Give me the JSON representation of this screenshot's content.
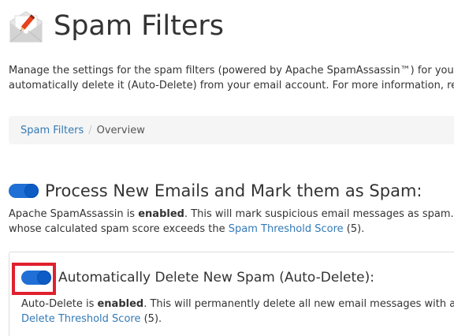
{
  "header": {
    "title": "Spam Filters",
    "icon": "envelope-pencil-icon"
  },
  "description": {
    "line1": "Manage the settings for the spam filters (powered by Apache SpamAssassin™) for your",
    "line2": "automatically delete it (Auto-Delete) from your email account. For more information, re"
  },
  "breadcrumb": {
    "link": "Spam Filters",
    "separator": "/",
    "current": "Overview"
  },
  "process_section": {
    "title": "Process New Emails and Mark them as Spam:",
    "toggle_state": "on",
    "desc_prefix": "Apache SpamAssassin is ",
    "desc_status": "enabled",
    "desc_middle": ". This will mark suspicious email messages as spam. T",
    "desc_line2_prefix": "whose calculated spam score exceeds the ",
    "threshold_link": "Spam Threshold Score",
    "threshold_value": " (5)."
  },
  "autodelete_section": {
    "title": "Automatically Delete New Spam (Auto-Delete):",
    "toggle_state": "on",
    "desc_prefix": "Auto-Delete is ",
    "desc_status": "enabled",
    "desc_middle": ". This will permanently delete all new email messages with a c",
    "threshold_link": "Delete Threshold Score",
    "threshold_value": " (5)."
  },
  "colors": {
    "toggle_on": "#1f6fd6",
    "link": "#337ab7",
    "highlight": "#e0202e"
  }
}
